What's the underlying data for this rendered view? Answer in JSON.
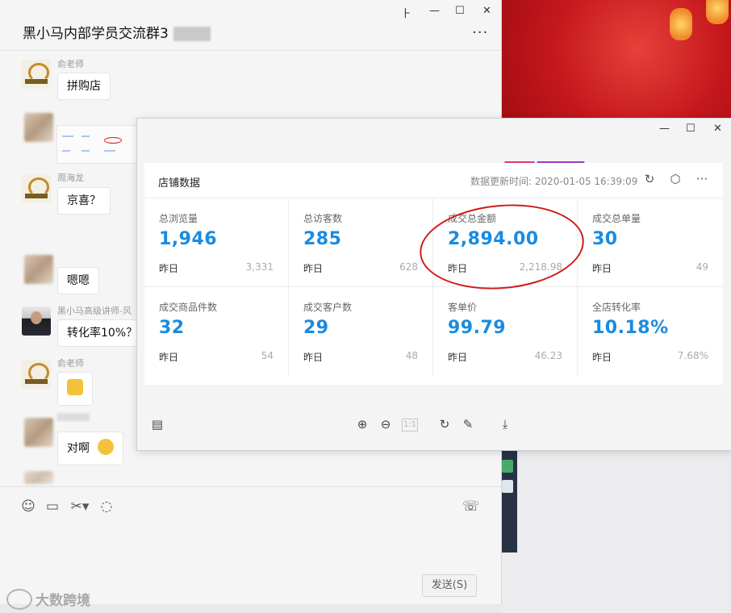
{
  "chat": {
    "title": "黑小马内部学员交流群3",
    "messages": [
      {
        "sender": "俞老师",
        "text": "拼购店"
      },
      {
        "sender": "周海龙",
        "text": "京喜？"
      },
      {
        "text": "嗯嗯"
      },
      {
        "sender": "黑小马高级讲师-风",
        "text": "转化率10%？"
      },
      {
        "sender": "俞老师"
      },
      {
        "text": "对啊"
      }
    ],
    "send_label": "发送(S)"
  },
  "window_controls": {
    "pin": "⺊",
    "minimize": "—",
    "maximize": "☐",
    "close": "✕"
  },
  "viewer": {
    "card_title": "店铺数据",
    "update_label": "数据更新时间: 2020-01-05 16:39:09",
    "metrics": [
      {
        "label": "总浏览量",
        "value": "1,946",
        "sub": "昨日",
        "prev": "3,331"
      },
      {
        "label": "总访客数",
        "value": "285",
        "sub": "昨日",
        "prev": "628"
      },
      {
        "label": "成交总金额",
        "value": "2,894.00",
        "sub": "昨日",
        "prev": "2,218.98"
      },
      {
        "label": "成交总单量",
        "value": "30",
        "sub": "昨日",
        "prev": "49"
      },
      {
        "label": "成交商品件数",
        "value": "32",
        "sub": "昨日",
        "prev": "54"
      },
      {
        "label": "成交客户数",
        "value": "29",
        "sub": "昨日",
        "prev": "48"
      },
      {
        "label": "客单价",
        "value": "99.79",
        "sub": "昨日",
        "prev": "46.23"
      },
      {
        "label": "全店转化率",
        "value": "10.18%",
        "sub": "昨日",
        "prev": "7.68%"
      }
    ],
    "actual_size_label": "1:1"
  },
  "watermark": "大数跨境",
  "colors": {
    "metric_value": "#1a8be0",
    "annotation": "#d21a1a",
    "festive_bg": "#c4171c"
  }
}
